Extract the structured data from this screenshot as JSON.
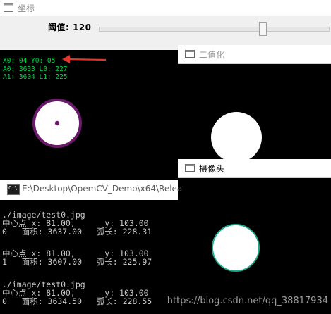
{
  "main_window": {
    "title": "坐标",
    "trackbar_label": "阈值: 120",
    "trackbar_value": 120,
    "overlay_lines": [
      "X0: 04 Y0: 05",
      "A0: 3633 L0: 227",
      "A1: 3604 L1: 225"
    ],
    "text_color": "#00d84a",
    "annotation_arrow_color": "#e0362b",
    "contour_color": "#6b1a6b"
  },
  "binary_window": {
    "title": "二值化"
  },
  "camera_window": {
    "title": "摄像头",
    "contour_color": "#1fa88a"
  },
  "console": {
    "title": "E:\\Desktop\\OpemCV_Demo\\x64\\Relea",
    "lines": [
      "./image/test0.jpg",
      "中心点 x: 81.00,      y: 103.00",
      "0   面积: 3637.00   弧长: 228.31",
      "",
      "中心点 x: 81.00,      y: 103.00",
      "1   面积: 3607.00   弧长: 225.97",
      "",
      "./image/test0.jpg",
      "中心点 x: 81.00,      y: 103.00",
      "0   面积: 3634.50   弧长: 228.55"
    ]
  },
  "watermark": "https://blog.csdn.net/qq_38817934"
}
